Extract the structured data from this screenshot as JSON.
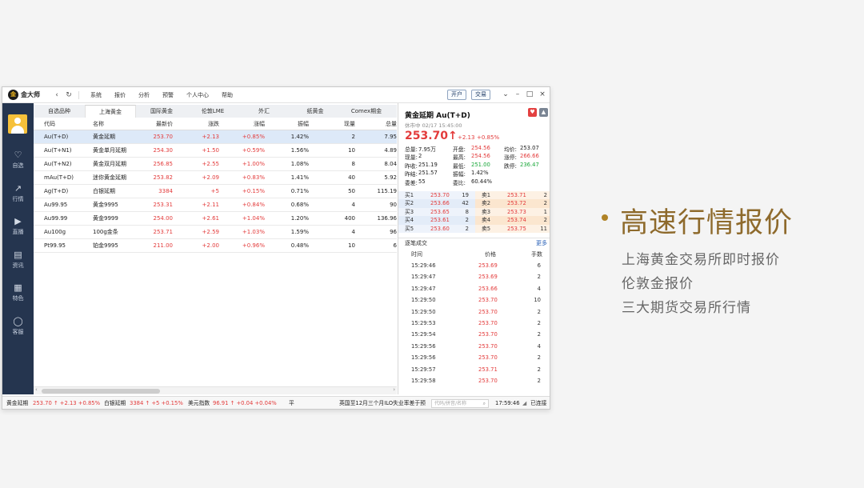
{
  "app": {
    "logo_text": "金大师",
    "logo_badge": "金",
    "menu": [
      "系统",
      "报价",
      "分析",
      "预警",
      "个人中心",
      "帮助"
    ],
    "open_account": "开户",
    "trade": "交易"
  },
  "sidebar": [
    {
      "icon": "♡",
      "label": "自选"
    },
    {
      "icon": "↗",
      "label": "行情"
    },
    {
      "icon": "▶",
      "label": "直播"
    },
    {
      "icon": "▤",
      "label": "资讯"
    },
    {
      "icon": "▦",
      "label": "特色"
    },
    {
      "icon": "◯",
      "label": "客服"
    }
  ],
  "tabs": [
    "自选品种",
    "上海黄金",
    "国际黄金",
    "伦敦LME",
    "外汇",
    "纸黄金",
    "Comex期金"
  ],
  "table": {
    "headers": [
      "代码",
      "名称",
      "最新价",
      "涨跌",
      "涨幅",
      "振幅",
      "现量",
      "总量"
    ],
    "rows": [
      [
        "Au(T+D)",
        "黄金延期",
        "253.70",
        "+2.13",
        "+0.85%",
        "1.42%",
        "2",
        "7.95"
      ],
      [
        "Au(T+N1)",
        "黄金单月延期",
        "254.30",
        "+1.50",
        "+0.59%",
        "1.56%",
        "10",
        "4.89"
      ],
      [
        "Au(T+N2)",
        "黄金双月延期",
        "256.85",
        "+2.55",
        "+1.00%",
        "1.08%",
        "8",
        "8.04"
      ],
      [
        "mAu(T+D)",
        "迷你黄金延期",
        "253.82",
        "+2.09",
        "+0.83%",
        "1.41%",
        "40",
        "5.92"
      ],
      [
        "Ag(T+D)",
        "白银延期",
        "3384",
        "+5",
        "+0.15%",
        "0.71%",
        "50",
        "115.19"
      ],
      [
        "Au99.95",
        "黄金9995",
        "253.31",
        "+2.11",
        "+0.84%",
        "0.68%",
        "4",
        "90"
      ],
      [
        "Au99.99",
        "黄金9999",
        "254.00",
        "+2.61",
        "+1.04%",
        "1.20%",
        "400",
        "136.96"
      ],
      [
        "Au100g",
        "100g金条",
        "253.71",
        "+2.59",
        "+1.03%",
        "1.59%",
        "4",
        "96"
      ],
      [
        "Pt99.95",
        "铂金9995",
        "211.00",
        "+2.00",
        "+0.96%",
        "0.48%",
        "10",
        "6"
      ]
    ]
  },
  "detail": {
    "title": "黄金延期   Au(T+D)",
    "status": "休市中   02/17 15:45:00",
    "price": "253.70",
    "arrow": "↑",
    "change": "+2.13",
    "change_pct": "+0.85%",
    "stats": [
      {
        "k": "总量:",
        "v": "7.95万"
      },
      {
        "k": "开盘:",
        "v": "254.56"
      },
      {
        "k": "均价:",
        "v": "253.07"
      },
      {
        "k": "现量:",
        "v": "2"
      },
      {
        "k": "最高:",
        "v": "254.56"
      },
      {
        "k": "涨停:",
        "v": "266.66"
      },
      {
        "k": "昨收:",
        "v": "251.19"
      },
      {
        "k": "最低:",
        "v": "251.00"
      },
      {
        "k": "跌停:",
        "v": "236.47"
      },
      {
        "k": "昨结:",
        "v": "251.57"
      },
      {
        "k": "振幅:",
        "v": "1.42%"
      },
      {
        "k": "",
        "v": ""
      },
      {
        "k": "委差:",
        "v": "55"
      },
      {
        "k": "委比:",
        "v": "60.44%"
      },
      {
        "k": "",
        "v": ""
      }
    ],
    "book": [
      {
        "bl": "买1",
        "bp": "253.70",
        "bv": "19",
        "sl": "卖1",
        "sp": "253.71",
        "sv": "2"
      },
      {
        "bl": "买2",
        "bp": "253.66",
        "bv": "42",
        "sl": "卖2",
        "sp": "253.72",
        "sv": "2"
      },
      {
        "bl": "买3",
        "bp": "253.65",
        "bv": "8",
        "sl": "卖3",
        "sp": "253.73",
        "sv": "1"
      },
      {
        "bl": "买4",
        "bp": "253.61",
        "bv": "2",
        "sl": "卖4",
        "sp": "253.74",
        "sv": "2"
      },
      {
        "bl": "买5",
        "bp": "253.60",
        "bv": "2",
        "sl": "卖5",
        "sp": "253.75",
        "sv": "11"
      }
    ],
    "ticks_title": "逐笔成交",
    "ticks_more": "更多",
    "ticks_headers": [
      "时间",
      "价格",
      "手数"
    ],
    "ticks": [
      [
        "15:29:46",
        "253.69",
        "6"
      ],
      [
        "15:29:47",
        "253.69",
        "2"
      ],
      [
        "15:29:47",
        "253.66",
        "4"
      ],
      [
        "15:29:50",
        "253.70",
        "10"
      ],
      [
        "15:29:50",
        "253.70",
        "2"
      ],
      [
        "15:29:53",
        "253.70",
        "2"
      ],
      [
        "15:29:54",
        "253.70",
        "2"
      ],
      [
        "15:29:56",
        "253.70",
        "4"
      ],
      [
        "15:29:56",
        "253.70",
        "2"
      ],
      [
        "15:29:57",
        "253.71",
        "2"
      ],
      [
        "15:29:58",
        "253.70",
        "2"
      ]
    ]
  },
  "statusbar": {
    "i1_name": "黄金延期",
    "i1_val": "253.70 ↑ +2.13  +0.85%",
    "i2_name": "白银延期",
    "i2_val": "3384 ↑ +5  +0.15%",
    "i3_name": "美元指数",
    "i3_val": "96.91 ↑ +0.04  +0.04%",
    "flat": "平",
    "news": "英国至12月三个月ILO失业率差于预",
    "search_placeholder": "代码/拼音/名称",
    "time": "17:59:46",
    "conn": "已连接"
  },
  "promo": {
    "headline": "高速行情报价",
    "lines": [
      "上海黄金交易所即时报价",
      "伦敦金报价",
      "三大期货交易所行情"
    ]
  },
  "colors": {
    "up": "#e33b3b",
    "down": "#1aa83a",
    "sidebar": "#25354f",
    "accent": "#8e6a2c"
  }
}
